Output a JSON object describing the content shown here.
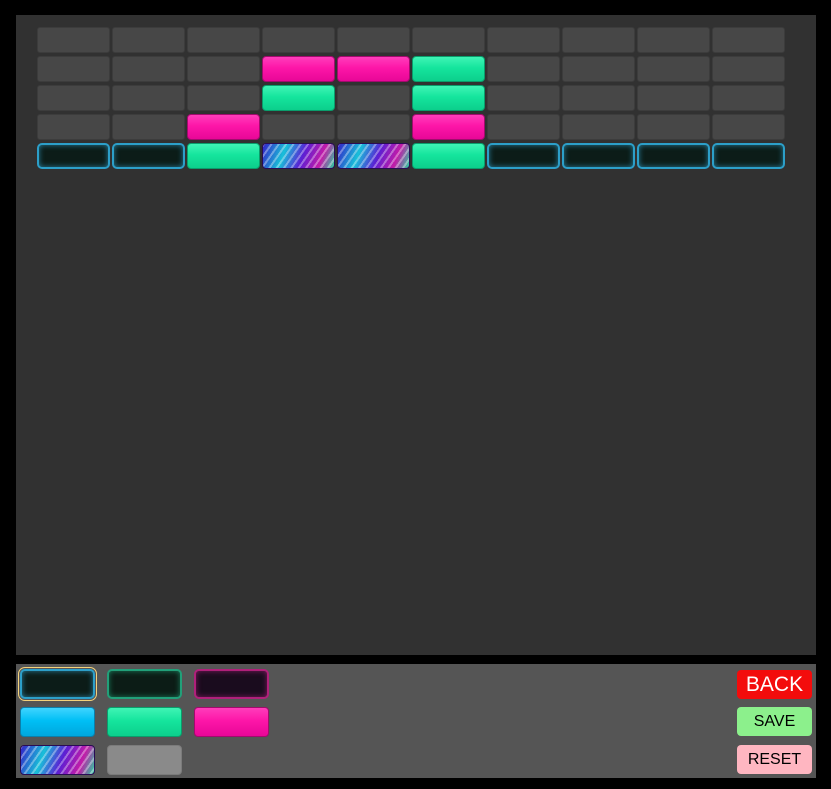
{
  "board": {
    "columns": 10,
    "rows": [
      [
        "empty",
        "empty",
        "empty",
        "empty",
        "empty",
        "empty",
        "empty",
        "empty",
        "empty",
        "empty"
      ],
      [
        "empty",
        "empty",
        "empty",
        "magenta",
        "magenta",
        "green",
        "empty",
        "empty",
        "empty",
        "empty"
      ],
      [
        "empty",
        "empty",
        "empty",
        "green",
        "empty",
        "green",
        "empty",
        "empty",
        "empty",
        "empty"
      ],
      [
        "empty",
        "empty",
        "magenta",
        "empty",
        "empty",
        "magenta",
        "empty",
        "empty",
        "empty",
        "empty"
      ],
      [
        "dark-cyan",
        "dark-cyan",
        "green",
        "rainbow",
        "rainbow",
        "green",
        "dark-cyan",
        "dark-cyan",
        "dark-cyan",
        "dark-cyan"
      ]
    ]
  },
  "palette": {
    "selected": "dark-cyan",
    "rows": [
      [
        "dark-cyan",
        "dark-green",
        "dark-magenta"
      ],
      [
        "cyan",
        "green",
        "magenta"
      ],
      [
        "rainbow",
        "gray"
      ]
    ]
  },
  "buttons": {
    "back": "BACK",
    "save": "SAVE",
    "reset": "RESET"
  },
  "colors": {
    "background": "#000000",
    "board": "#313131",
    "panel": "#555555",
    "empty": "#474747",
    "cyan": "#00bff5",
    "green": "#15e59d",
    "magenta": "#fd16a8",
    "back_button": "#f30c0c",
    "save_button": "#8cf08c",
    "reset_button": "#ffb6c1"
  }
}
